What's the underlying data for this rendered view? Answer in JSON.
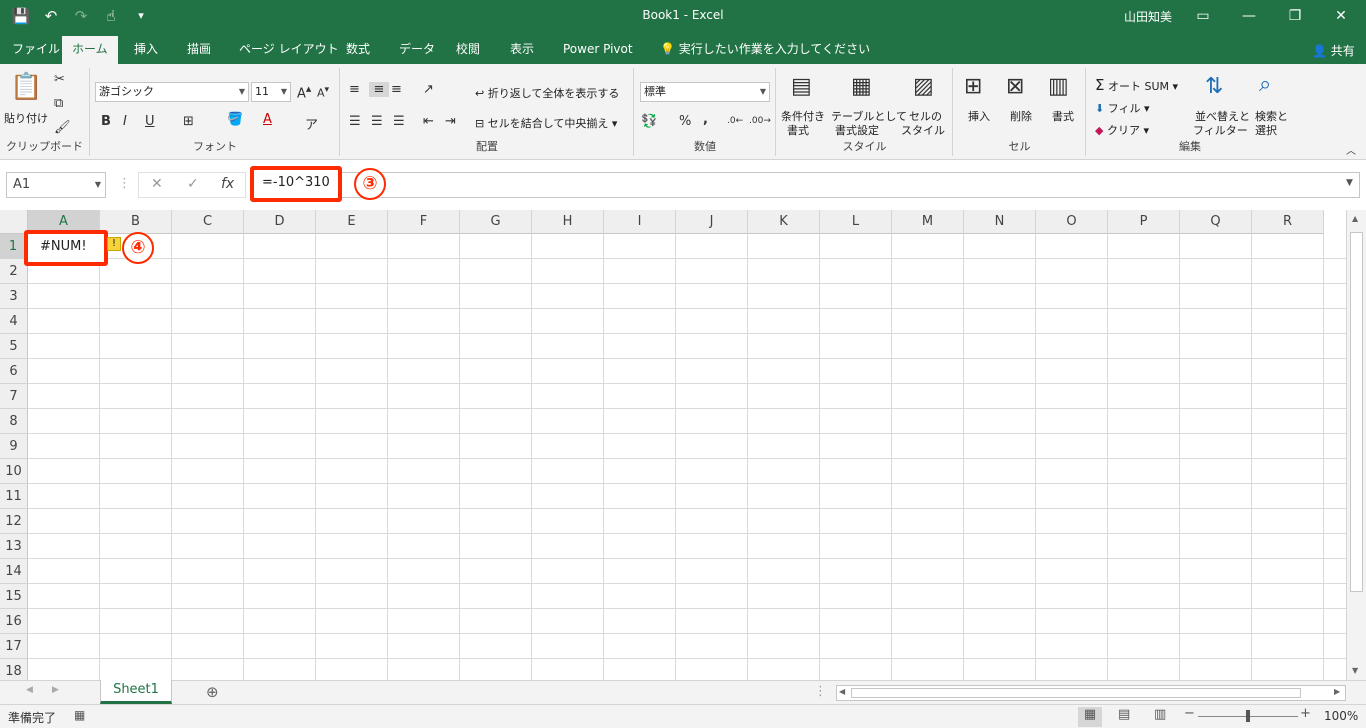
{
  "window": {
    "title": "Book1  -  Excel",
    "user": "山田知美",
    "minimize": "—",
    "restore": "❐",
    "close": "✕"
  },
  "qat": {
    "save": "💾",
    "undo": "↶",
    "redo": "↷",
    "touch": "☝",
    "customize": "▾"
  },
  "tabs": [
    "ファイル",
    "ホーム",
    "挿入",
    "描画",
    "ページ レイアウト",
    "数式",
    "データ",
    "校閲",
    "表示",
    "Power Pivot",
    "実行したい作業を入力してください"
  ],
  "share": "共有",
  "ribbon": {
    "clipboard": {
      "label": "クリップボード",
      "paste": "貼り付け"
    },
    "font": {
      "label": "フォント",
      "name": "游ゴシック",
      "size": "11",
      "bold": "B",
      "italic": "I",
      "underline": "U"
    },
    "alignment": {
      "label": "配置",
      "wrap": "折り返して全体を表示する",
      "merge": "セルを結合して中央揃え"
    },
    "number": {
      "label": "数値",
      "format": "標準",
      "percent": "%",
      "comma": ","
    },
    "styles": {
      "label": "スタイル",
      "conditional": [
        "条件付き",
        "書式"
      ],
      "table": [
        "テーブルとして",
        "書式設定"
      ],
      "cell": [
        "セルの",
        "スタイル"
      ]
    },
    "cells": {
      "label": "セル",
      "insert": "挿入",
      "delete": "削除",
      "format": "書式"
    },
    "editing": {
      "label": "編集",
      "autosum": "オート SUM",
      "fill": "フィル",
      "clear": "クリア",
      "sort": [
        "並べ替えと",
        "フィルター"
      ],
      "find": [
        "検索と",
        "選択"
      ]
    }
  },
  "formula_bar": {
    "name_box": "A1",
    "cancel": "✕",
    "enter": "✓",
    "fx": "fx",
    "formula": "=-10^310"
  },
  "annotations": {
    "step3": "③",
    "step4": "④"
  },
  "columns": [
    "A",
    "B",
    "C",
    "D",
    "E",
    "F",
    "G",
    "H",
    "I",
    "J",
    "K",
    "L",
    "M",
    "N",
    "O",
    "P",
    "Q",
    "R"
  ],
  "rows": [
    "1",
    "2",
    "3",
    "4",
    "5",
    "6",
    "7",
    "8",
    "9",
    "10",
    "11",
    "12",
    "13",
    "14",
    "15",
    "16",
    "17",
    "18"
  ],
  "cells": {
    "A1": "#NUM!"
  },
  "sheet_tab": "Sheet1",
  "add_sheet": "⊕",
  "status": {
    "ready": "準備完了",
    "zoom": "100%"
  },
  "colors": {
    "accent": "#217346",
    "highlight": "#ff2a00"
  }
}
